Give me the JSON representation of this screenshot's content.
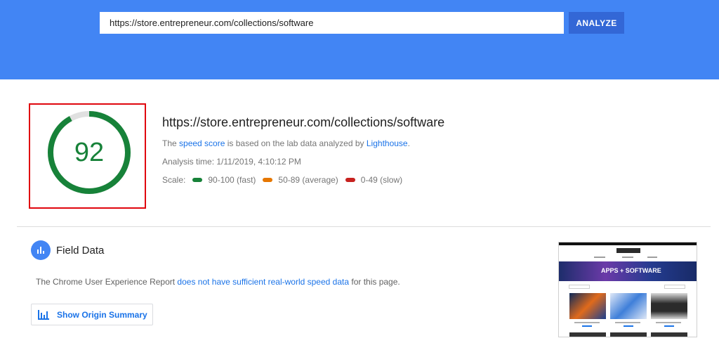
{
  "header": {
    "url_value": "https://store.entrepreneur.com/collections/software",
    "analyze_label": "ANALYZE"
  },
  "score": {
    "value": "92",
    "fraction": 0.92,
    "color": "#178239"
  },
  "summary": {
    "url": "https://store.entrepreneur.com/collections/software",
    "desc_prefix": "The ",
    "desc_link1": "speed score",
    "desc_middle": " is based on the lab data analyzed by ",
    "desc_link2": "Lighthouse",
    "desc_suffix": ".",
    "analysis_time": "Analysis time: 1/11/2019, 4:10:12 PM",
    "scale_label": "Scale:",
    "scale": [
      {
        "label": "90-100 (fast)",
        "color": "#178239"
      },
      {
        "label": "50-89 (average)",
        "color": "#e67700"
      },
      {
        "label": "0-49 (slow)",
        "color": "#c7221f"
      }
    ]
  },
  "field_data": {
    "title": "Field Data",
    "text_prefix": "The Chrome User Experience Report ",
    "text_link": "does not have sufficient real-world speed data",
    "text_suffix": " for this page.",
    "origin_button_label": "Show Origin Summary"
  },
  "screenshot": {
    "banner_text": "APPS + SOFTWARE"
  },
  "colors": {
    "header_bg": "#4285f4",
    "button_bg": "#3367d6",
    "link": "#1a73e8",
    "highlight_border": "#e0060e"
  }
}
